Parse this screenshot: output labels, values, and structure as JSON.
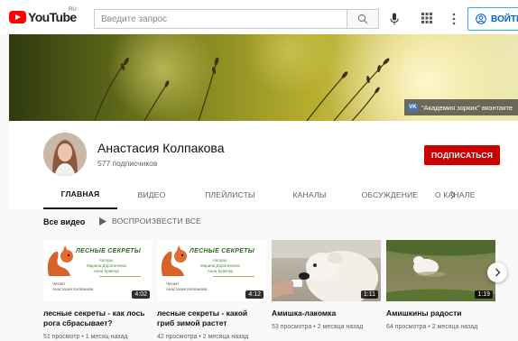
{
  "topbar": {
    "logo_text": "YouTube",
    "logo_region": "RU",
    "search_placeholder": "Введите запрос",
    "signin_label": "ВОЙТИ"
  },
  "banner": {
    "link_badge": "VK",
    "link_label": "\"Академия зорких\" вконтакте"
  },
  "channel": {
    "name": "Анастасия Колпакова",
    "subscribers": "577 подписчиков",
    "subscribe_label": "ПОДПИСАТЬСЯ"
  },
  "tabs": [
    {
      "label": "ГЛАВНАЯ",
      "active": true
    },
    {
      "label": "ВИДЕО"
    },
    {
      "label": "ПЛЕЙЛИСТЫ"
    },
    {
      "label": "КАНАЛЫ"
    },
    {
      "label": "ОБСУЖДЕНИЕ"
    },
    {
      "label": "О КАНАЛЕ"
    }
  ],
  "section": {
    "title": "Все видео",
    "play_all": "ВОСПРОИЗВЕСТИ ВСЕ"
  },
  "promo": {
    "title": "ЛЕСНЫЕ СЕКРЕТЫ",
    "authors_label": "Авторы:",
    "author1": "Марина Дорогаченко",
    "author2": "Анна Кравчук",
    "reader_label": "Читает",
    "reader_name": "Анастасия Колпакова"
  },
  "videos": [
    {
      "title": "лесные секреты - как лось рога сбрасывает?",
      "duration": "4:02",
      "meta": "51 просмотр • 1 месяц назад"
    },
    {
      "title": "лесные секреты - какой гриб зимой растет",
      "duration": "4:12",
      "meta": "42 просмотра • 2 месяца назад"
    },
    {
      "title": "Амишка-лакомка",
      "duration": "1:11",
      "meta": "53 просмотра • 2 месяца назад"
    },
    {
      "title": "Амишкины радости",
      "duration": "1:19",
      "meta": "64 просмотра • 2 месяца назад"
    }
  ],
  "colors": {
    "brand_red": "#ff0000",
    "subscribe_red": "#cc0000",
    "link_blue": "#065fd4"
  }
}
